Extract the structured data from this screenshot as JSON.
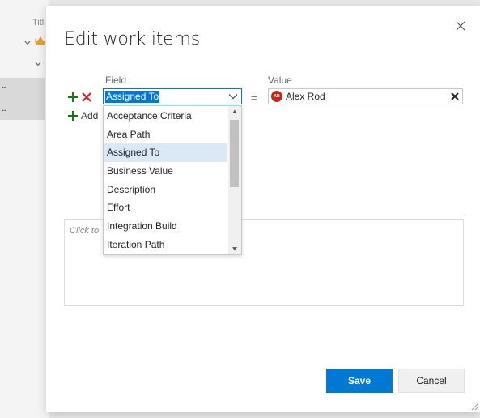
{
  "background": {
    "column_header": "Titl",
    "row_dots": [
      "..",
      ".."
    ]
  },
  "dialog": {
    "title": "Edit work items",
    "close_icon": "close-icon"
  },
  "editor": {
    "field_header": "Field",
    "value_header": "Value",
    "row": {
      "field_value": "Assigned To",
      "operator": "=",
      "value": "Alex Rod",
      "avatar_initials": "AR",
      "avatar_color": "#c0281e"
    },
    "add_label": "Add"
  },
  "dropdown": {
    "options": [
      "Acceptance Criteria",
      "Area Path",
      "Assigned To",
      "Business Value",
      "Description",
      "Effort",
      "Integration Build",
      "Iteration Path"
    ],
    "selected": "Assigned To"
  },
  "notes": {
    "placeholder": "Click to"
  },
  "footer": {
    "save_label": "Save",
    "cancel_label": "Cancel"
  },
  "colors": {
    "accent": "#0078d4",
    "add_green": "#107c10",
    "remove_red": "#e81123",
    "crown_orange": "#e8a13a"
  }
}
